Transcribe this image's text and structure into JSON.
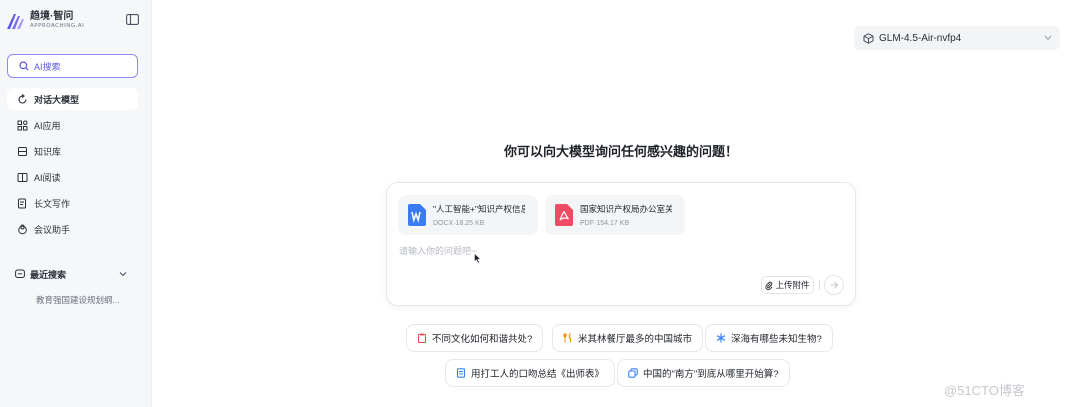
{
  "sidebar": {
    "logo_cn": "趋境·智问",
    "logo_en": "APPROACHING.AI",
    "ai_search_label": "AI搜索",
    "nav": [
      {
        "label": "对话大模型"
      },
      {
        "label": "AI应用"
      },
      {
        "label": "知识库"
      },
      {
        "label": "AI阅读"
      },
      {
        "label": "长文写作"
      },
      {
        "label": "会议助手"
      }
    ],
    "recent_title": "最近搜索",
    "recent_items": [
      "教育强国建设规划纲..."
    ]
  },
  "model_selector": {
    "value": "GLM-4.5-Air-nvfp4"
  },
  "headline": "你可以向大模型询问任何感兴趣的问题！",
  "chat": {
    "files": [
      {
        "name": "\"人工智能+\"知识产权信息",
        "meta": "DOCX·18.25 KB",
        "type": "docx"
      },
      {
        "name": "国家知识产权局办公室关于",
        "meta": "PDF·154.17 KB",
        "type": "pdf"
      }
    ],
    "placeholder": "请输入你的问题吧~",
    "upload_label": "上传附件"
  },
  "suggestions": [
    {
      "label": "不同文化如何和谐共处?",
      "icon": "clipboard-icon",
      "color": "#e5484d"
    },
    {
      "label": "米其林餐厅最多的中国城市",
      "icon": "fork-knife-icon",
      "color": "#f08c00"
    },
    {
      "label": "深海有哪些未知生物?",
      "icon": "asterisk-icon",
      "color": "#3b82f6"
    },
    {
      "label": "用打工人的口吻总结《出师表》",
      "icon": "document-icon",
      "color": "#3b82f6"
    },
    {
      "label": "中国的\"南方\"到底从哪里开始算?",
      "icon": "copy-icon",
      "color": "#3b82f6"
    }
  ],
  "watermark": "@51CTO博客",
  "colors": {
    "accent": "#5b55e8",
    "sidebar_bg": "#f6f7f9",
    "docx": "#3b7cf5",
    "pdf": "#ef4b64"
  }
}
